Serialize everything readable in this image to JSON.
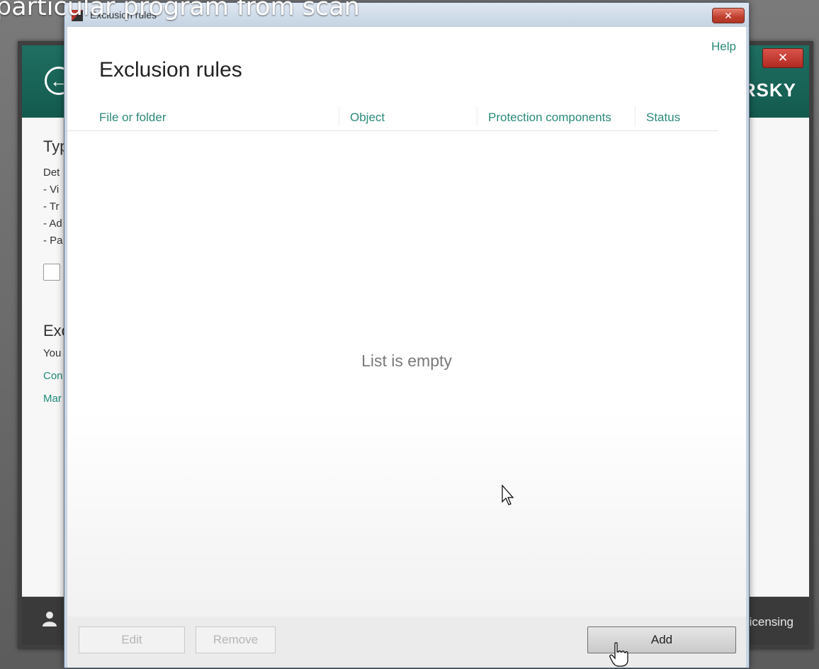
{
  "overlay": {
    "caption": "particular program from scan"
  },
  "background_window": {
    "logo": "ERSKY",
    "close_glyph": "✕",
    "back_glyph": "←",
    "type_heading": "Typ",
    "detect_lines": [
      "Det",
      "- Vi",
      "- Tr",
      "- Ad",
      "- Pa"
    ],
    "exclusions_heading": "Exc",
    "you_text": "You",
    "link1": "Con",
    "link2": "Mar",
    "licensing": "icensing",
    "icons": {
      "back": "arrow-left-circle-icon",
      "user": "user-icon"
    }
  },
  "dialog": {
    "window_title": "Exclusion rules",
    "close_glyph": "✕",
    "help": "Help",
    "heading": "Exclusion rules",
    "columns": [
      "File or folder",
      "Object",
      "Protection components",
      "Status"
    ],
    "empty_text": "List is empty",
    "buttons": {
      "edit": "Edit",
      "remove": "Remove",
      "add": "Add"
    },
    "accent_color": "#2a8a7a"
  }
}
